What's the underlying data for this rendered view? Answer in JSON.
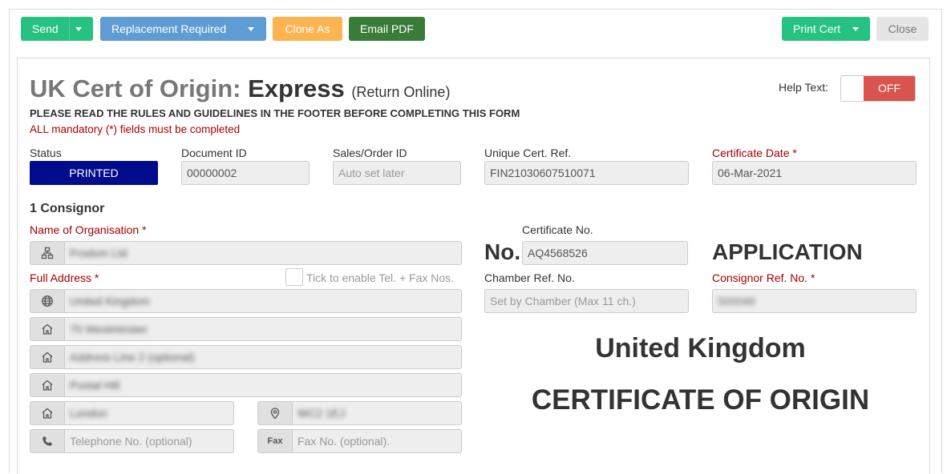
{
  "toolbar": {
    "send_label": "Send",
    "replacement_label": "Replacement Required",
    "clone_label": "Clone As",
    "email_pdf_label": "Email PDF",
    "print_cert_label": "Print Cert",
    "close_label": "Close"
  },
  "header": {
    "title_prefix": "UK Cert of Origin:",
    "title_main": "Express",
    "title_suffix": "(Return Online)",
    "notice_rules": "PLEASE READ THE RULES AND GUIDELINES IN THE FOOTER BEFORE COMPLETING THIS FORM",
    "notice_mandatory": "ALL mandatory (*) fields must be completed",
    "help_text_label": "Help Text:",
    "help_toggle_state": "OFF"
  },
  "summary": {
    "status_label": "Status",
    "status_value": "PRINTED",
    "document_id_label": "Document ID",
    "document_id_value": "00000002",
    "sales_order_label": "Sales/Order ID",
    "sales_order_placeholder": "Auto set later",
    "unique_ref_label": "Unique Cert. Ref.",
    "unique_ref_value": "FIN21030607510071",
    "cert_date_label": "Certificate Date *",
    "cert_date_value": "06-Mar-2021"
  },
  "consignor": {
    "section_title": "1 Consignor",
    "org_label": "Name of Organisation *",
    "org_value": "Frodom Ltd",
    "address_label": "Full Address *",
    "tel_fax_checkbox_label": "Tick to enable Tel. + Fax Nos.",
    "country_value": "United Kingdom",
    "address_line1": "70 Westminster",
    "address_line2_placeholder": "Address Line 2 (optional)",
    "address_line3": "Postal Hill",
    "city_value": "London",
    "postcode_value": "WC2 1EJ",
    "telephone_placeholder": "Telephone No. (optional)",
    "fax_addon": "Fax",
    "fax_placeholder": "Fax No. (optional)."
  },
  "certificate": {
    "cert_no_label": "Certificate No.",
    "no_prefix": "No.",
    "cert_no_value": "AQ4568526",
    "application_heading": "APPLICATION",
    "chamber_ref_label": "Chamber Ref. No.",
    "chamber_ref_placeholder": "Set by Chamber (Max 11 ch.)",
    "consignor_ref_label": "Consignor Ref. No. *",
    "consignor_ref_value": "500049",
    "country_heading": "United Kingdom",
    "doc_heading": "CERTIFICATE OF ORIGIN"
  },
  "colors": {
    "green": "#26c281",
    "blue": "#5e9cd3",
    "orange": "#fbb450",
    "dark_green": "#3a7d3a",
    "status_navy": "#000c8c",
    "toggle_red": "#d9534f",
    "required_red": "#a30000"
  },
  "icons": {
    "organisation": "sitemap-icon",
    "country": "globe-icon",
    "address": "home-icon",
    "postcode": "map-pin-icon",
    "telephone": "phone-icon"
  }
}
